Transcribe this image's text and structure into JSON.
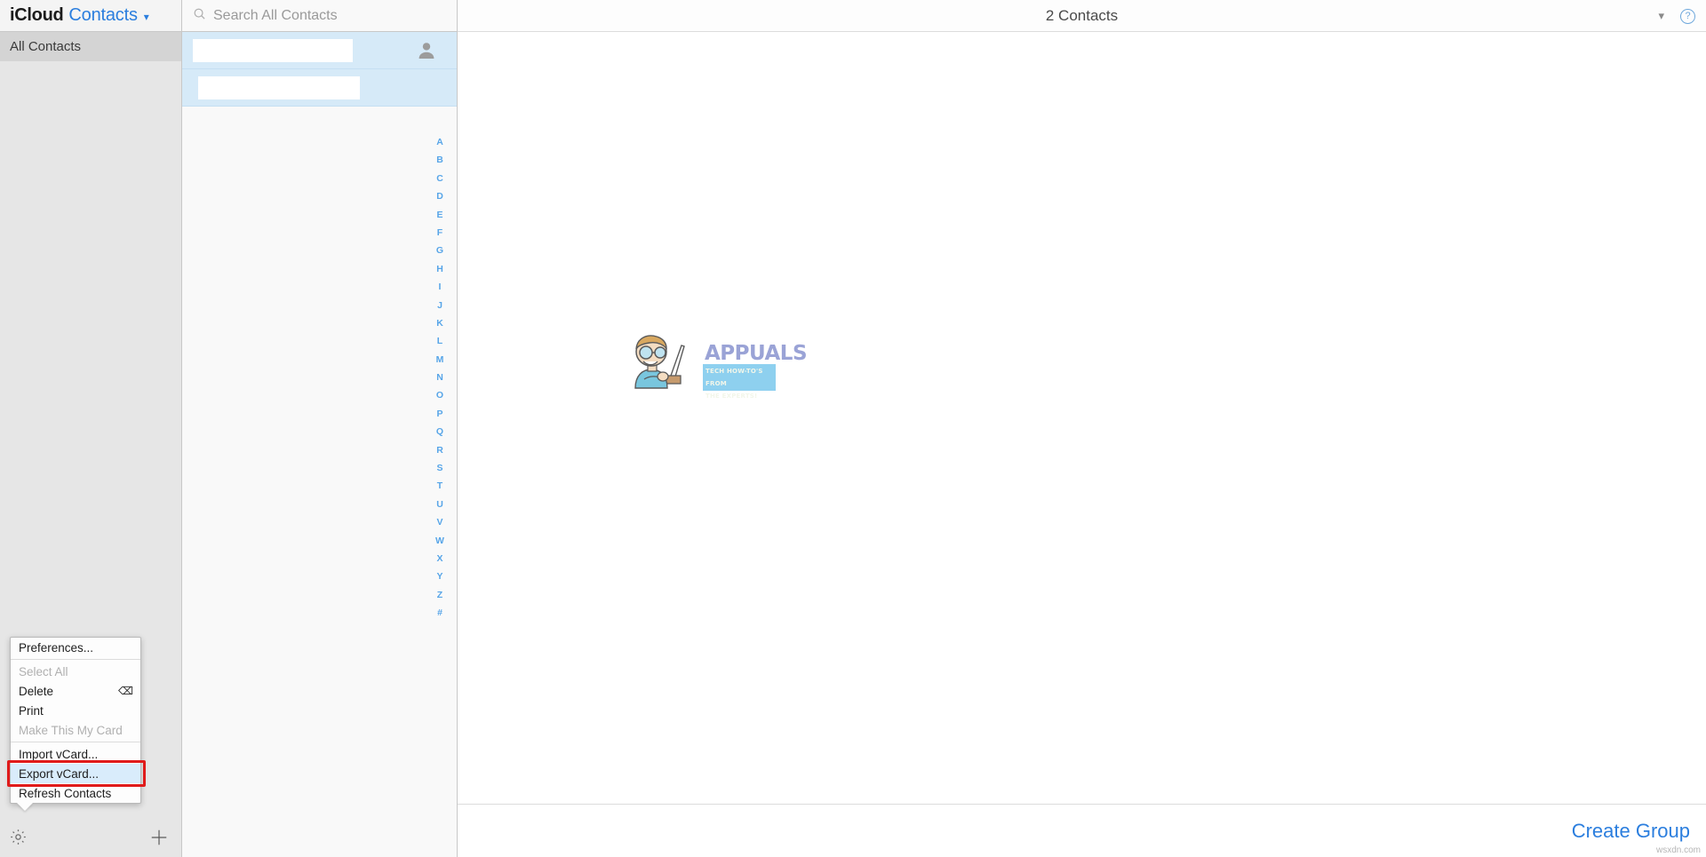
{
  "brand": {
    "icloud": "iCloud",
    "app": "Contacts",
    "chevron": "chevron-down"
  },
  "sidebar": {
    "groups": [
      {
        "label": "All Contacts",
        "selected": true
      }
    ],
    "bottom": {
      "settings_icon": "gear-icon",
      "add_icon": "plus-icon"
    }
  },
  "context_menu": {
    "items": [
      {
        "label": "Preferences...",
        "disabled": false,
        "highlighted": false,
        "shortcut": "",
        "separator_after": true
      },
      {
        "label": "Select All",
        "disabled": true,
        "highlighted": false,
        "shortcut": "",
        "separator_after": false
      },
      {
        "label": "Delete",
        "disabled": false,
        "highlighted": false,
        "shortcut": "⌫",
        "separator_after": false
      },
      {
        "label": "Print",
        "disabled": false,
        "highlighted": false,
        "shortcut": "",
        "separator_after": false
      },
      {
        "label": "Make This My Card",
        "disabled": true,
        "highlighted": false,
        "shortcut": "",
        "separator_after": true
      },
      {
        "label": "Import vCard...",
        "disabled": false,
        "highlighted": false,
        "shortcut": "",
        "separator_after": false
      },
      {
        "label": "Export vCard...",
        "disabled": false,
        "highlighted": true,
        "shortcut": "",
        "separator_after": false
      },
      {
        "label": "Refresh Contacts",
        "disabled": false,
        "highlighted": false,
        "shortcut": "",
        "separator_after": false
      }
    ],
    "highlight_color": "#e01b1b",
    "selected_bg": "#d9ecfb"
  },
  "search": {
    "placeholder": "Search All Contacts",
    "value": "",
    "icon": "search-icon"
  },
  "contact_list": {
    "rows": [
      {
        "redacted": true,
        "redact_width": 180,
        "has_avatar": true
      },
      {
        "redacted": true,
        "redact_width": 182,
        "has_avatar": false
      }
    ],
    "alphabet": [
      "A",
      "B",
      "C",
      "D",
      "E",
      "F",
      "G",
      "H",
      "I",
      "J",
      "K",
      "L",
      "M",
      "N",
      "O",
      "P",
      "Q",
      "R",
      "S",
      "T",
      "U",
      "V",
      "W",
      "X",
      "Y",
      "Z",
      "#"
    ],
    "alphabet_color": "#57a5e8"
  },
  "detail": {
    "title": "2 Contacts",
    "chevron_icon": "chevron-down-icon",
    "help_icon": "help-icon",
    "help_label": "?",
    "create_group": "Create Group",
    "create_group_color": "#2b7ede"
  },
  "watermark": {
    "main": "APPUALS",
    "tagline_line1": "TECH HOW-TO'S FROM",
    "tagline_line2": "THE EXPERTS!",
    "site": "wsxdn.com"
  }
}
